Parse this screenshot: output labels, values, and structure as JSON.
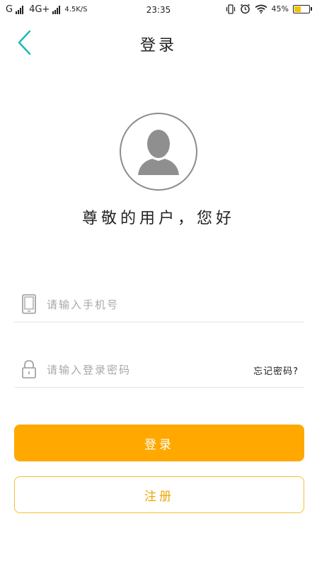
{
  "status_bar": {
    "carrier1": "G",
    "carrier2": "4G+",
    "net_speed": "4.5K/S",
    "time": "23:35",
    "battery_text": "45%",
    "battery_level": 0.45
  },
  "header": {
    "title": "登录",
    "back_icon": "chevron-left-icon"
  },
  "profile": {
    "avatar_icon": "user-silhouette-icon",
    "greeting": "尊敬的用户，您好"
  },
  "form": {
    "phone": {
      "icon": "phone-icon",
      "placeholder": "请输入手机号",
      "value": ""
    },
    "password": {
      "icon": "lock-icon",
      "placeholder": "请输入登录密码",
      "value": "",
      "forgot_label": "忘记密码?"
    }
  },
  "actions": {
    "login_label": "登录",
    "register_label": "注册"
  },
  "colors": {
    "accent": "#ffa800",
    "back_arrow": "#1bb9b2",
    "register_border": "#f3c035"
  }
}
